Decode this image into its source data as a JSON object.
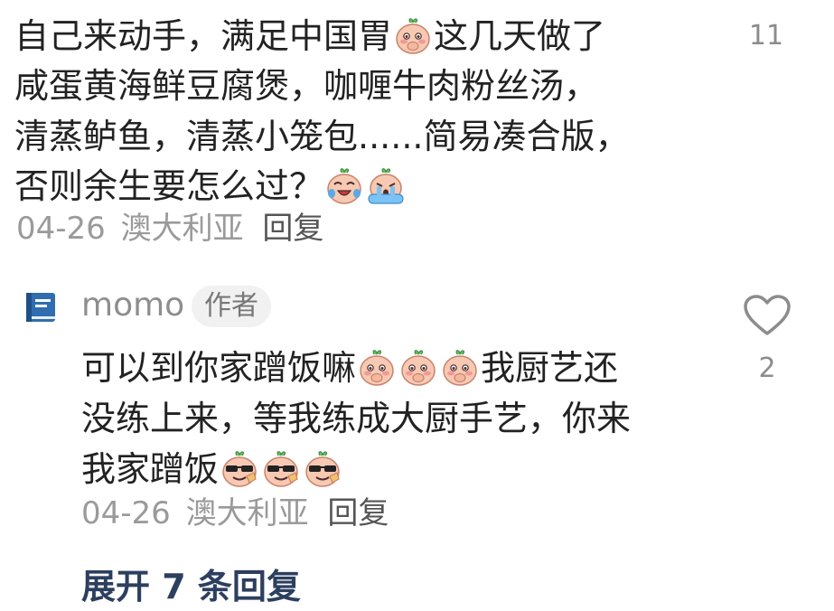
{
  "comment1": {
    "lines": [
      {
        "segments": [
          "自己来动手，满足中国胃",
          "@emoji:blush-hand",
          "这几天做了"
        ]
      },
      {
        "segments": [
          "咸蛋黄海鲜豆腐煲，咖喱牛肉粉丝汤，"
        ]
      },
      {
        "segments": [
          "清蒸鲈鱼，清蒸小笼包......简易凑合版，"
        ]
      },
      {
        "segments": [
          "否则余生要怎么过？",
          "@emoji:laugh-cry",
          "@emoji:crying-tears"
        ]
      }
    ],
    "date": "04-26",
    "location": "澳大利亚",
    "reply_label": "回复",
    "like_count": "11"
  },
  "comment2": {
    "username": "momo",
    "author_badge": "作者",
    "lines": [
      {
        "segments": [
          "可以到你家蹭饭嘛",
          "@emoji:blush-hand",
          "@emoji:blush-hand",
          "@emoji:blush-hand",
          "我厨艺还"
        ]
      },
      {
        "segments": [
          "没练上来，等我练成大厨手艺，你来"
        ]
      },
      {
        "segments": [
          "我家蹭饭",
          "@emoji:sunglasses-cool",
          "@emoji:sunglasses-cool",
          "@emoji:sunglasses-cool"
        ]
      }
    ],
    "date": "04-26",
    "location": "澳大利亚",
    "reply_label": "回复",
    "like_count": "2"
  },
  "expand_label": "展开 7 条回复",
  "colors": {
    "text": "#222222",
    "meta": "#9a9a9a",
    "link": "#2c3f5f",
    "avatar": "#2f6db0",
    "badge_bg": "#f1f1f1"
  },
  "icons": [
    "heart-outline-icon",
    "book-avatar-icon",
    "blush-hand-emoji-icon",
    "laugh-cry-emoji-icon",
    "crying-tears-emoji-icon",
    "sunglasses-cool-emoji-icon"
  ]
}
